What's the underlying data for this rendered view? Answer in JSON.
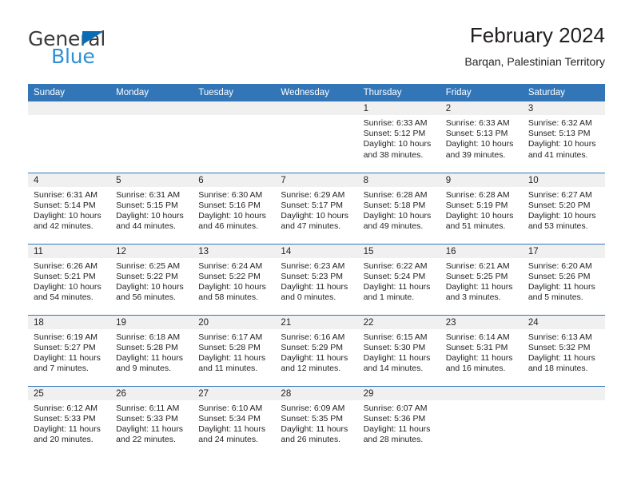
{
  "brand": {
    "name_top": "General",
    "name_bottom": "Blue",
    "accent_blue": "#0b6bb5",
    "light_blue": "#2f8fd6"
  },
  "header": {
    "title": "February 2024",
    "subtitle": "Barqan, Palestinian Territory",
    "header_bg": "#3276b8",
    "daynum_bg": "#f0f0f0"
  },
  "weekday_headers": [
    "Sunday",
    "Monday",
    "Tuesday",
    "Wednesday",
    "Thursday",
    "Friday",
    "Saturday"
  ],
  "weeks": [
    [
      {
        "day": "",
        "sunrise": "",
        "sunset": "",
        "daylight1": "",
        "daylight2": ""
      },
      {
        "day": "",
        "sunrise": "",
        "sunset": "",
        "daylight1": "",
        "daylight2": ""
      },
      {
        "day": "",
        "sunrise": "",
        "sunset": "",
        "daylight1": "",
        "daylight2": ""
      },
      {
        "day": "",
        "sunrise": "",
        "sunset": "",
        "daylight1": "",
        "daylight2": ""
      },
      {
        "day": "1",
        "sunrise": "Sunrise: 6:33 AM",
        "sunset": "Sunset: 5:12 PM",
        "daylight1": "Daylight: 10 hours",
        "daylight2": "and 38 minutes."
      },
      {
        "day": "2",
        "sunrise": "Sunrise: 6:33 AM",
        "sunset": "Sunset: 5:13 PM",
        "daylight1": "Daylight: 10 hours",
        "daylight2": "and 39 minutes."
      },
      {
        "day": "3",
        "sunrise": "Sunrise: 6:32 AM",
        "sunset": "Sunset: 5:13 PM",
        "daylight1": "Daylight: 10 hours",
        "daylight2": "and 41 minutes."
      }
    ],
    [
      {
        "day": "4",
        "sunrise": "Sunrise: 6:31 AM",
        "sunset": "Sunset: 5:14 PM",
        "daylight1": "Daylight: 10 hours",
        "daylight2": "and 42 minutes."
      },
      {
        "day": "5",
        "sunrise": "Sunrise: 6:31 AM",
        "sunset": "Sunset: 5:15 PM",
        "daylight1": "Daylight: 10 hours",
        "daylight2": "and 44 minutes."
      },
      {
        "day": "6",
        "sunrise": "Sunrise: 6:30 AM",
        "sunset": "Sunset: 5:16 PM",
        "daylight1": "Daylight: 10 hours",
        "daylight2": "and 46 minutes."
      },
      {
        "day": "7",
        "sunrise": "Sunrise: 6:29 AM",
        "sunset": "Sunset: 5:17 PM",
        "daylight1": "Daylight: 10 hours",
        "daylight2": "and 47 minutes."
      },
      {
        "day": "8",
        "sunrise": "Sunrise: 6:28 AM",
        "sunset": "Sunset: 5:18 PM",
        "daylight1": "Daylight: 10 hours",
        "daylight2": "and 49 minutes."
      },
      {
        "day": "9",
        "sunrise": "Sunrise: 6:28 AM",
        "sunset": "Sunset: 5:19 PM",
        "daylight1": "Daylight: 10 hours",
        "daylight2": "and 51 minutes."
      },
      {
        "day": "10",
        "sunrise": "Sunrise: 6:27 AM",
        "sunset": "Sunset: 5:20 PM",
        "daylight1": "Daylight: 10 hours",
        "daylight2": "and 53 minutes."
      }
    ],
    [
      {
        "day": "11",
        "sunrise": "Sunrise: 6:26 AM",
        "sunset": "Sunset: 5:21 PM",
        "daylight1": "Daylight: 10 hours",
        "daylight2": "and 54 minutes."
      },
      {
        "day": "12",
        "sunrise": "Sunrise: 6:25 AM",
        "sunset": "Sunset: 5:22 PM",
        "daylight1": "Daylight: 10 hours",
        "daylight2": "and 56 minutes."
      },
      {
        "day": "13",
        "sunrise": "Sunrise: 6:24 AM",
        "sunset": "Sunset: 5:22 PM",
        "daylight1": "Daylight: 10 hours",
        "daylight2": "and 58 minutes."
      },
      {
        "day": "14",
        "sunrise": "Sunrise: 6:23 AM",
        "sunset": "Sunset: 5:23 PM",
        "daylight1": "Daylight: 11 hours",
        "daylight2": "and 0 minutes."
      },
      {
        "day": "15",
        "sunrise": "Sunrise: 6:22 AM",
        "sunset": "Sunset: 5:24 PM",
        "daylight1": "Daylight: 11 hours",
        "daylight2": "and 1 minute."
      },
      {
        "day": "16",
        "sunrise": "Sunrise: 6:21 AM",
        "sunset": "Sunset: 5:25 PM",
        "daylight1": "Daylight: 11 hours",
        "daylight2": "and 3 minutes."
      },
      {
        "day": "17",
        "sunrise": "Sunrise: 6:20 AM",
        "sunset": "Sunset: 5:26 PM",
        "daylight1": "Daylight: 11 hours",
        "daylight2": "and 5 minutes."
      }
    ],
    [
      {
        "day": "18",
        "sunrise": "Sunrise: 6:19 AM",
        "sunset": "Sunset: 5:27 PM",
        "daylight1": "Daylight: 11 hours",
        "daylight2": "and 7 minutes."
      },
      {
        "day": "19",
        "sunrise": "Sunrise: 6:18 AM",
        "sunset": "Sunset: 5:28 PM",
        "daylight1": "Daylight: 11 hours",
        "daylight2": "and 9 minutes."
      },
      {
        "day": "20",
        "sunrise": "Sunrise: 6:17 AM",
        "sunset": "Sunset: 5:28 PM",
        "daylight1": "Daylight: 11 hours",
        "daylight2": "and 11 minutes."
      },
      {
        "day": "21",
        "sunrise": "Sunrise: 6:16 AM",
        "sunset": "Sunset: 5:29 PM",
        "daylight1": "Daylight: 11 hours",
        "daylight2": "and 12 minutes."
      },
      {
        "day": "22",
        "sunrise": "Sunrise: 6:15 AM",
        "sunset": "Sunset: 5:30 PM",
        "daylight1": "Daylight: 11 hours",
        "daylight2": "and 14 minutes."
      },
      {
        "day": "23",
        "sunrise": "Sunrise: 6:14 AM",
        "sunset": "Sunset: 5:31 PM",
        "daylight1": "Daylight: 11 hours",
        "daylight2": "and 16 minutes."
      },
      {
        "day": "24",
        "sunrise": "Sunrise: 6:13 AM",
        "sunset": "Sunset: 5:32 PM",
        "daylight1": "Daylight: 11 hours",
        "daylight2": "and 18 minutes."
      }
    ],
    [
      {
        "day": "25",
        "sunrise": "Sunrise: 6:12 AM",
        "sunset": "Sunset: 5:33 PM",
        "daylight1": "Daylight: 11 hours",
        "daylight2": "and 20 minutes."
      },
      {
        "day": "26",
        "sunrise": "Sunrise: 6:11 AM",
        "sunset": "Sunset: 5:33 PM",
        "daylight1": "Daylight: 11 hours",
        "daylight2": "and 22 minutes."
      },
      {
        "day": "27",
        "sunrise": "Sunrise: 6:10 AM",
        "sunset": "Sunset: 5:34 PM",
        "daylight1": "Daylight: 11 hours",
        "daylight2": "and 24 minutes."
      },
      {
        "day": "28",
        "sunrise": "Sunrise: 6:09 AM",
        "sunset": "Sunset: 5:35 PM",
        "daylight1": "Daylight: 11 hours",
        "daylight2": "and 26 minutes."
      },
      {
        "day": "29",
        "sunrise": "Sunrise: 6:07 AM",
        "sunset": "Sunset: 5:36 PM",
        "daylight1": "Daylight: 11 hours",
        "daylight2": "and 28 minutes."
      },
      {
        "day": "",
        "sunrise": "",
        "sunset": "",
        "daylight1": "",
        "daylight2": ""
      },
      {
        "day": "",
        "sunrise": "",
        "sunset": "",
        "daylight1": "",
        "daylight2": ""
      }
    ]
  ]
}
